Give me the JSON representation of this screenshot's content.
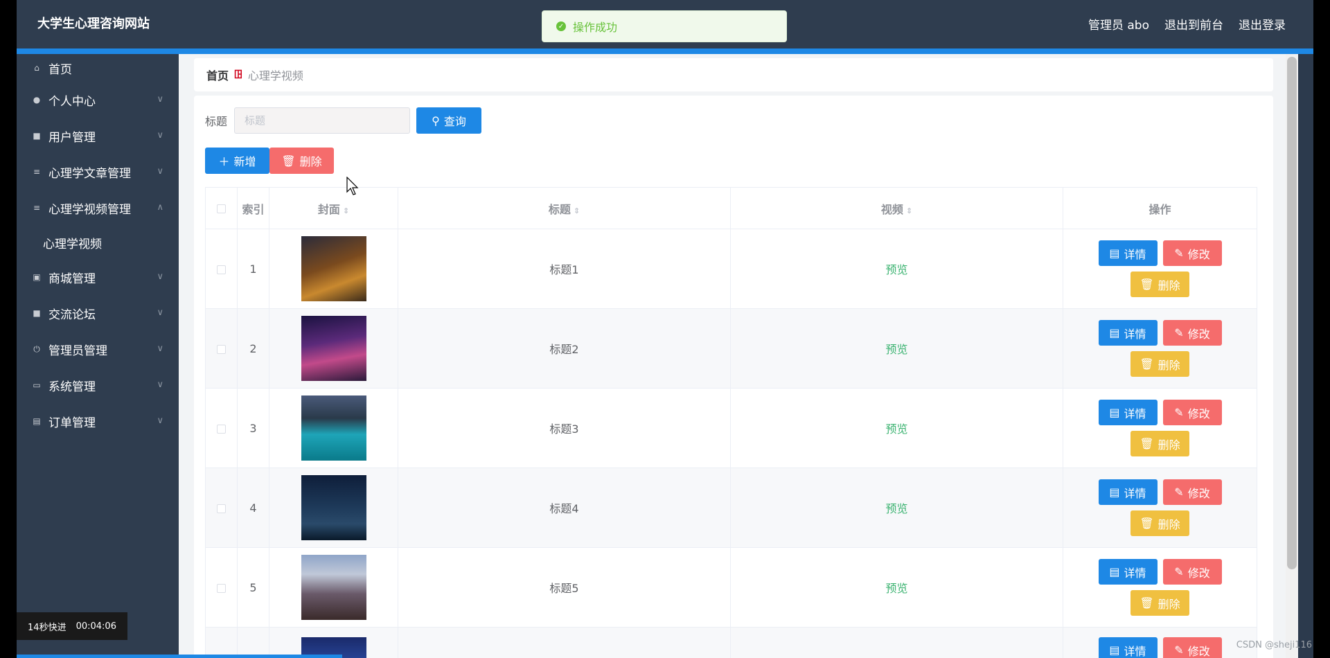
{
  "header": {
    "brand": "大学生心理咨询网站",
    "admin_label": "管理员 abo",
    "to_front": "退出到前台",
    "logout": "退出登录"
  },
  "toast": {
    "message": "操作成功"
  },
  "sidebar": {
    "items": [
      {
        "label": "首页",
        "icon": "home-icon"
      },
      {
        "label": "个人中心",
        "icon": "user-icon"
      },
      {
        "label": "用户管理",
        "icon": "monitor-icon"
      },
      {
        "label": "心理学文章管理",
        "icon": "list-icon"
      },
      {
        "label": "心理学视频管理",
        "icon": "list-icon"
      },
      {
        "label": "商城管理",
        "icon": "chart-icon"
      },
      {
        "label": "交流论坛",
        "icon": "monitor-icon"
      },
      {
        "label": "管理员管理",
        "icon": "power-icon"
      },
      {
        "label": "系统管理",
        "icon": "chat-icon"
      },
      {
        "label": "订单管理",
        "icon": "clipboard-icon"
      }
    ],
    "sub_item": "心理学视频"
  },
  "breadcrumb": {
    "home": "首页",
    "current": "心理学视频"
  },
  "search": {
    "label": "标题",
    "placeholder": "标题",
    "button": "查询"
  },
  "toolbar": {
    "add": "新增",
    "delete": "删除"
  },
  "table": {
    "columns": [
      "索引",
      "封面",
      "标题",
      "视频",
      "操作"
    ],
    "rows": [
      {
        "index": "1",
        "title": "标题1",
        "video": "预览"
      },
      {
        "index": "2",
        "title": "标题2",
        "video": "预览"
      },
      {
        "index": "3",
        "title": "标题3",
        "video": "预览"
      },
      {
        "index": "4",
        "title": "标题4",
        "video": "预览"
      },
      {
        "index": "5",
        "title": "标题5",
        "video": "预览"
      },
      {
        "index": "",
        "title": "",
        "video": ""
      }
    ],
    "ops": {
      "detail": "详情",
      "edit": "修改",
      "delete": "删除"
    }
  },
  "overlay": {
    "speed": "14秒快进",
    "time": "00:04:06"
  },
  "watermark": "CSDN @sheji116",
  "colors": {
    "primary": "#1e88e5",
    "danger": "#f56c6c",
    "warning": "#f0c040",
    "success": "#67c23a",
    "sidebar": "#2f3d4f"
  }
}
